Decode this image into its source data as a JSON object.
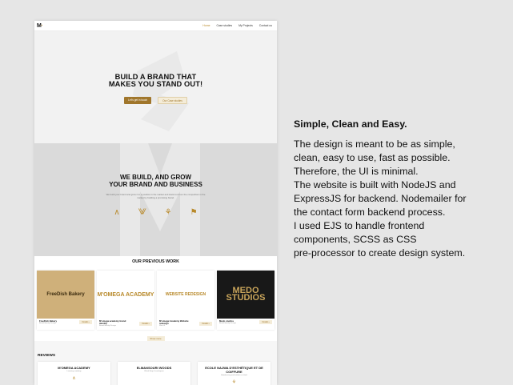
{
  "site": {
    "logo": "M",
    "logo_accent": "·",
    "nav": [
      "Home",
      "Case studies",
      "My Projects",
      "Contact us"
    ],
    "hero": {
      "title": "BUILD A BRAND THAT\nMAKES YOU STAND OUT!",
      "primary_button": "Let's get in touch",
      "secondary_button": "Our Case studies"
    },
    "build": {
      "title": "WE BUILD, AND GROW\nYOUR BRAND AND BUSINESS",
      "text": "We build your brand and grow it to a position in the market and stand out from the competitors in the market by building a promising brand.",
      "service_icons": [
        "brand-icon",
        "logo-icon",
        "web-icon",
        "marketing-icon"
      ]
    },
    "work": {
      "title": "OUR PREVIOUS WORK",
      "projects": [
        {
          "thumb": "FreeDish Bakery",
          "title": "FreeDish Bakery",
          "sub": "Brand Identity Design",
          "button": "Details ›"
        },
        {
          "thumb": "M'OMEGA ACADEMY",
          "title": "M'omega academy brand identity",
          "sub": "Brand Identity Design",
          "button": "Details ›"
        },
        {
          "thumb": "WEBSITE REDESIGN",
          "title": "M'omega Academy Website redesign",
          "sub": "Web UI",
          "button": "Details ›"
        },
        {
          "thumb": "MEDO STUDIOS",
          "title": "Medo studios",
          "sub": "Brand Identity Design",
          "button": "Details ›"
        }
      ],
      "more_button": "Show more"
    },
    "reviews": {
      "title": "REVIEWS",
      "items": [
        {
          "name": "M'OMEGA ACADEMY",
          "sub": "Learning academy"
        },
        {
          "name": "ELMANSOURI WOODS",
          "sub": "Wood Shop & workspace"
        },
        {
          "name": "ECOLE NAJWA D'ESTHÉTIQUE ET DE COIFFURE",
          "sub": "Hairdressing and esthetics school"
        }
      ]
    }
  },
  "description": {
    "title": "Simple, Clean and Easy.",
    "lines": [
      "The design is meant to be as simple,",
      "clean, easy to use, fast as possible.",
      "Therefore, the UI is minimal.",
      "The website is built with NodeJS and",
      "ExpressJS for backend. Nodemailer for",
      "the contact form backend process.",
      "I used EJS to handle frontend",
      "components, SCSS as CSS",
      "pre-processor to create design system."
    ]
  },
  "colors": {
    "accent": "#b8892a",
    "background": "#e6e6e6",
    "dark": "#111111"
  }
}
